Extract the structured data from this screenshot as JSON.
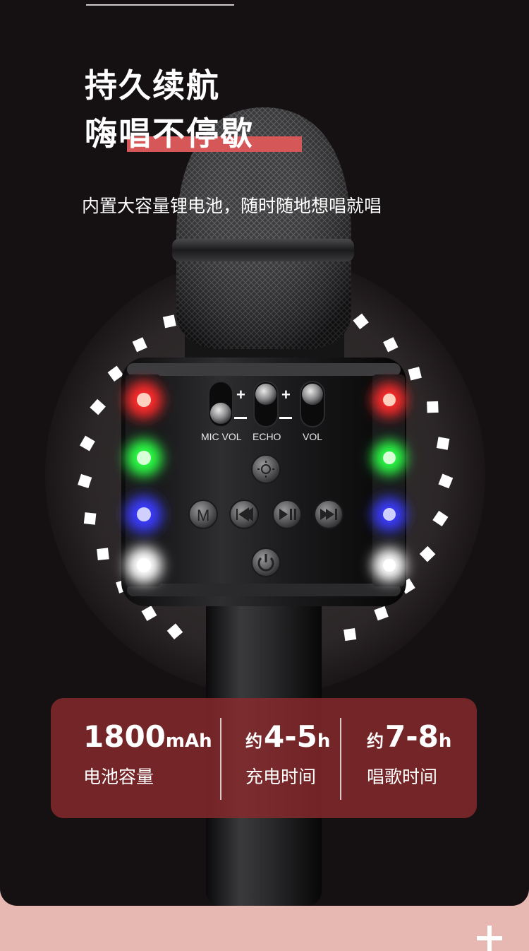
{
  "headline": {
    "line1": "持久续航",
    "line2": "嗨唱不停歇",
    "subtitle": "内置大容量锂电池，随时随地想唱就唱"
  },
  "mic_controls": {
    "mic_vol_label": "MIC VOL",
    "echo_label": "ECHO",
    "vol_label": "VOL",
    "plus_sign": "+",
    "minus_sign": "–",
    "mode_button_glyph": "M",
    "icons": [
      "light-icon",
      "mode-m-icon",
      "previous-icon",
      "play-pause-icon",
      "next-icon",
      "power-icon"
    ],
    "led_colors": [
      "#ff2a2a",
      "#2aff44",
      "#3b3bff",
      "#ffffff"
    ]
  },
  "specs": [
    {
      "value": "1800",
      "unit": "mAh",
      "prefix": "",
      "label": "电池容量"
    },
    {
      "value": "4-5",
      "unit": "h",
      "prefix": "约",
      "label": "充电时间"
    },
    {
      "value": "7-8",
      "unit": "h",
      "prefix": "约",
      "label": "唱歌时间"
    }
  ],
  "colors": {
    "background": "#151112",
    "page_bottom": "#e7b8b1",
    "accent_red": "#d65757",
    "card": "#8a2a2c"
  }
}
